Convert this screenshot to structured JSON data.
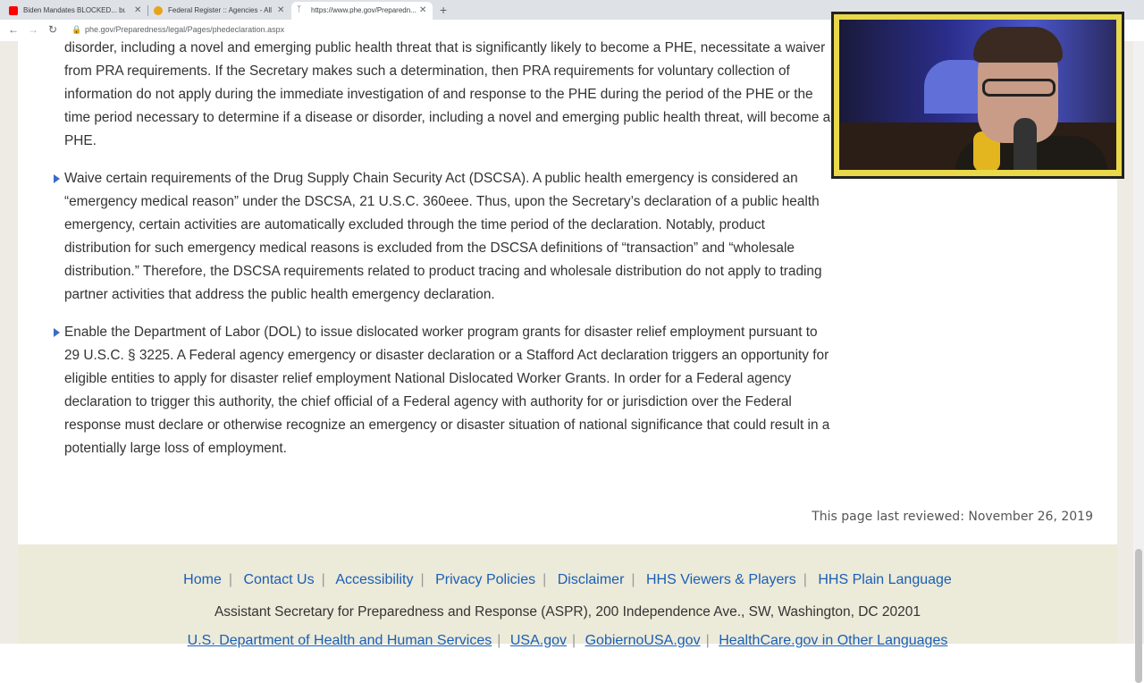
{
  "browser": {
    "tabs": [
      {
        "title": "Biden Mandates BLOCKED... but",
        "favicon_color": "#ff0000"
      },
      {
        "title": "Federal Register :: Agencies - All",
        "favicon_color": "#e8a317"
      },
      {
        "title": "https://www.phe.gov/Preparedn...",
        "favicon_color": "#5f6368"
      }
    ],
    "close_glyph": "✕",
    "new_tab_glyph": "+",
    "back_glyph": "←",
    "forward_glyph": "→",
    "reload_glyph": "↻",
    "lock_glyph": "🔒",
    "url": "phe.gov/Preparedness/legal/Pages/phedeclaration.aspx"
  },
  "content": {
    "para1": "disorder, including a novel and emerging public health threat that is significantly likely to become a PHE, necessitate a waiver from PRA requirements. If the Secretary makes such a determination, then PRA requirements for voluntary collection of information do not apply during the immediate investigation of and response to the PHE during the period of the PHE or the time period necessary to determine if a disease or disorder, including a novel and emerging public health threat, will become a PHE.",
    "bullet1": "Waive certain requirements of the Drug Supply Chain Security Act (DSCSA). A public health emergency is considered an “emergency medical reason” under the DSCSA, 21 U.S.C. 360eee. Thus, upon the Secretary’s declaration of a public health emergency, certain activities are automatically excluded through the time period of the declaration. Notably, product distribution for such emergency medical reasons is excluded from the DSCSA definitions of “transaction” and “wholesale distribution.” Therefore, the DSCSA requirements related to product tracing and wholesale distribution do not apply to trading partner activities that address the public health emergency declaration.",
    "bullet2": "Enable the Department of Labor (DOL) to issue dislocated worker program grants for disaster relief employment pursuant to 29 U.S.C. § 3225. A Federal agency emergency or disaster declaration or a Stafford Act declaration triggers an opportunity for eligible entities to apply for disaster relief employment National Dislocated Worker Grants. In order for a Federal agency declaration to trigger this authority, the chief official of a Federal agency with authority for or jurisdiction over the Federal response must declare or otherwise recognize an emergency or disaster situation of national significance that could result in a potentially large loss of employment.",
    "last_reviewed": "This page last reviewed: November 26, 2019"
  },
  "footer": {
    "links": [
      "Home",
      "Contact Us",
      "Accessibility",
      "Privacy Policies",
      "Disclaimer",
      "HHS Viewers & Players",
      "HHS Plain Language"
    ],
    "address": "Assistant Secretary for Preparedness and Response (ASPR), 200 Independence Ave., SW, Washington, DC 20201",
    "links2": [
      "U.S. Department of Health and Human Services",
      "USA.gov",
      "GobiernoUSA.gov",
      "HealthCare.gov in Other Languages"
    ]
  },
  "colors": {
    "link": "#1a5fb4",
    "bullet": "#3a6cc6",
    "cam_border": "#e8d84a"
  }
}
